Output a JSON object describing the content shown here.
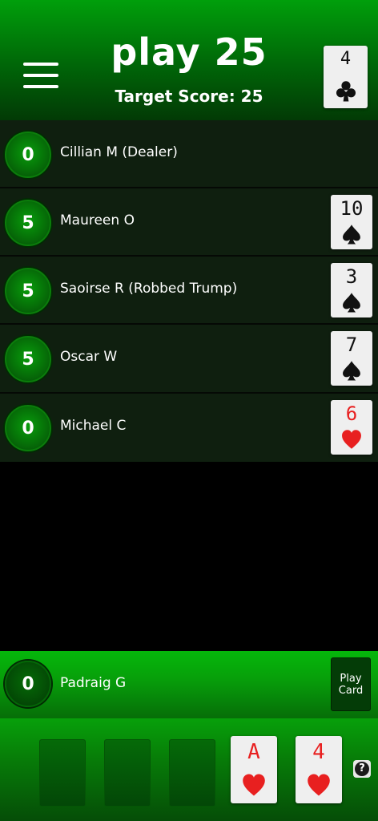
{
  "header": {
    "title": "play 25",
    "target_score": "Target Score: 25",
    "trump_card": {
      "rank": "4",
      "suit": "clubs",
      "color": "black"
    }
  },
  "players": [
    {
      "score": "0",
      "name": "Cillian M (Dealer)",
      "card": null
    },
    {
      "score": "5",
      "name": "Maureen O",
      "card": {
        "rank": "10",
        "suit": "spades",
        "color": "black"
      }
    },
    {
      "score": "5",
      "name": "Saoirse R (Robbed Trump)",
      "card": {
        "rank": "3",
        "suit": "spades",
        "color": "black"
      }
    },
    {
      "score": "5",
      "name": "Oscar W",
      "card": {
        "rank": "7",
        "suit": "spades",
        "color": "black"
      }
    },
    {
      "score": "0",
      "name": "Michael C",
      "card": {
        "rank": "6",
        "suit": "hearts",
        "color": "red"
      }
    }
  ],
  "me": {
    "score": "0",
    "name": "Padraig G",
    "play_button_label": "Play Card"
  },
  "hand": {
    "empty_slots": 3,
    "cards": [
      {
        "rank": "A",
        "suit": "hearts",
        "color": "red"
      },
      {
        "rank": "4",
        "suit": "hearts",
        "color": "red"
      }
    ],
    "help_icon": "question-icon"
  },
  "colors": {
    "header_green": "#009f0b",
    "row_bg": "#0f1f0f",
    "red_suit": "#e82020",
    "black_suit": "#111111"
  }
}
